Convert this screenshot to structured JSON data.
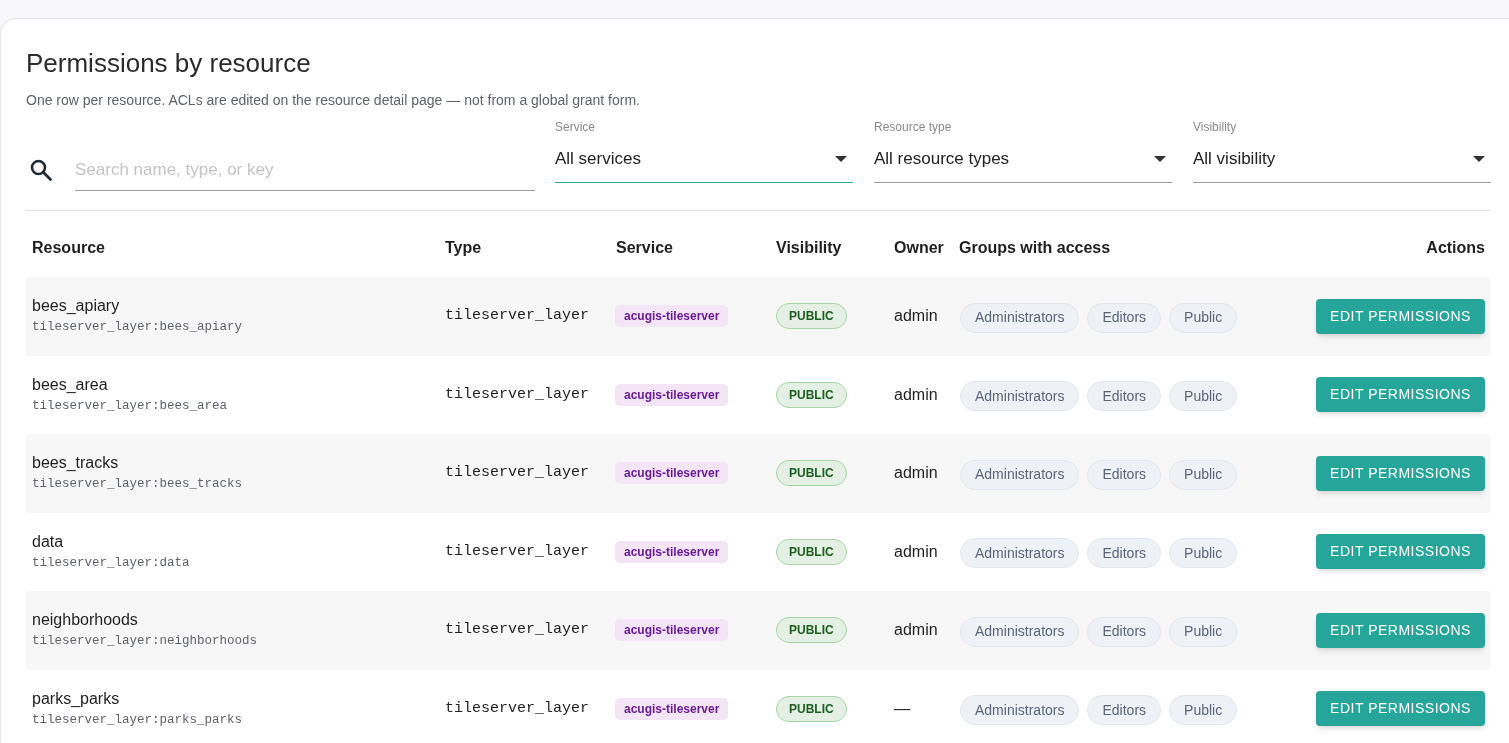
{
  "page": {
    "title": "Permissions by resource",
    "subtitle": "One row per resource. ACLs are edited on the resource detail page — not from a global grant form."
  },
  "search": {
    "placeholder": "Search name, type, or key"
  },
  "filters": [
    {
      "label": "Service",
      "value": "All services",
      "focused": true
    },
    {
      "label": "Resource type",
      "value": "All resource types",
      "focused": false
    },
    {
      "label": "Visibility",
      "value": "All visibility",
      "focused": false
    }
  ],
  "table": {
    "columns": [
      "Resource",
      "Type",
      "Service",
      "Visibility",
      "Owner",
      "Groups with access",
      "Actions"
    ],
    "rows": [
      {
        "name": "bees_apiary",
        "key": "tileserver_layer:bees_apiary",
        "type": "tileserver_layer",
        "service": "acugis-tileserver",
        "visibility": "PUBLIC",
        "owner": "admin",
        "groups": [
          "Administrators",
          "Editors",
          "Public"
        ],
        "action": "EDIT PERMISSIONS"
      },
      {
        "name": "bees_area",
        "key": "tileserver_layer:bees_area",
        "type": "tileserver_layer",
        "service": "acugis-tileserver",
        "visibility": "PUBLIC",
        "owner": "admin",
        "groups": [
          "Administrators",
          "Editors",
          "Public"
        ],
        "action": "EDIT PERMISSIONS"
      },
      {
        "name": "bees_tracks",
        "key": "tileserver_layer:bees_tracks",
        "type": "tileserver_layer",
        "service": "acugis-tileserver",
        "visibility": "PUBLIC",
        "owner": "admin",
        "groups": [
          "Administrators",
          "Editors",
          "Public"
        ],
        "action": "EDIT PERMISSIONS"
      },
      {
        "name": "data",
        "key": "tileserver_layer:data",
        "type": "tileserver_layer",
        "service": "acugis-tileserver",
        "visibility": "PUBLIC",
        "owner": "admin",
        "groups": [
          "Administrators",
          "Editors",
          "Public"
        ],
        "action": "EDIT PERMISSIONS"
      },
      {
        "name": "neighborhoods",
        "key": "tileserver_layer:neighborhoods",
        "type": "tileserver_layer",
        "service": "acugis-tileserver",
        "visibility": "PUBLIC",
        "owner": "admin",
        "groups": [
          "Administrators",
          "Editors",
          "Public"
        ],
        "action": "EDIT PERMISSIONS"
      },
      {
        "name": "parks_parks",
        "key": "tileserver_layer:parks_parks",
        "type": "tileserver_layer",
        "service": "acugis-tileserver",
        "visibility": "PUBLIC",
        "owner": "—",
        "groups": [
          "Administrators",
          "Editors",
          "Public"
        ],
        "action": "EDIT PERMISSIONS"
      }
    ]
  }
}
